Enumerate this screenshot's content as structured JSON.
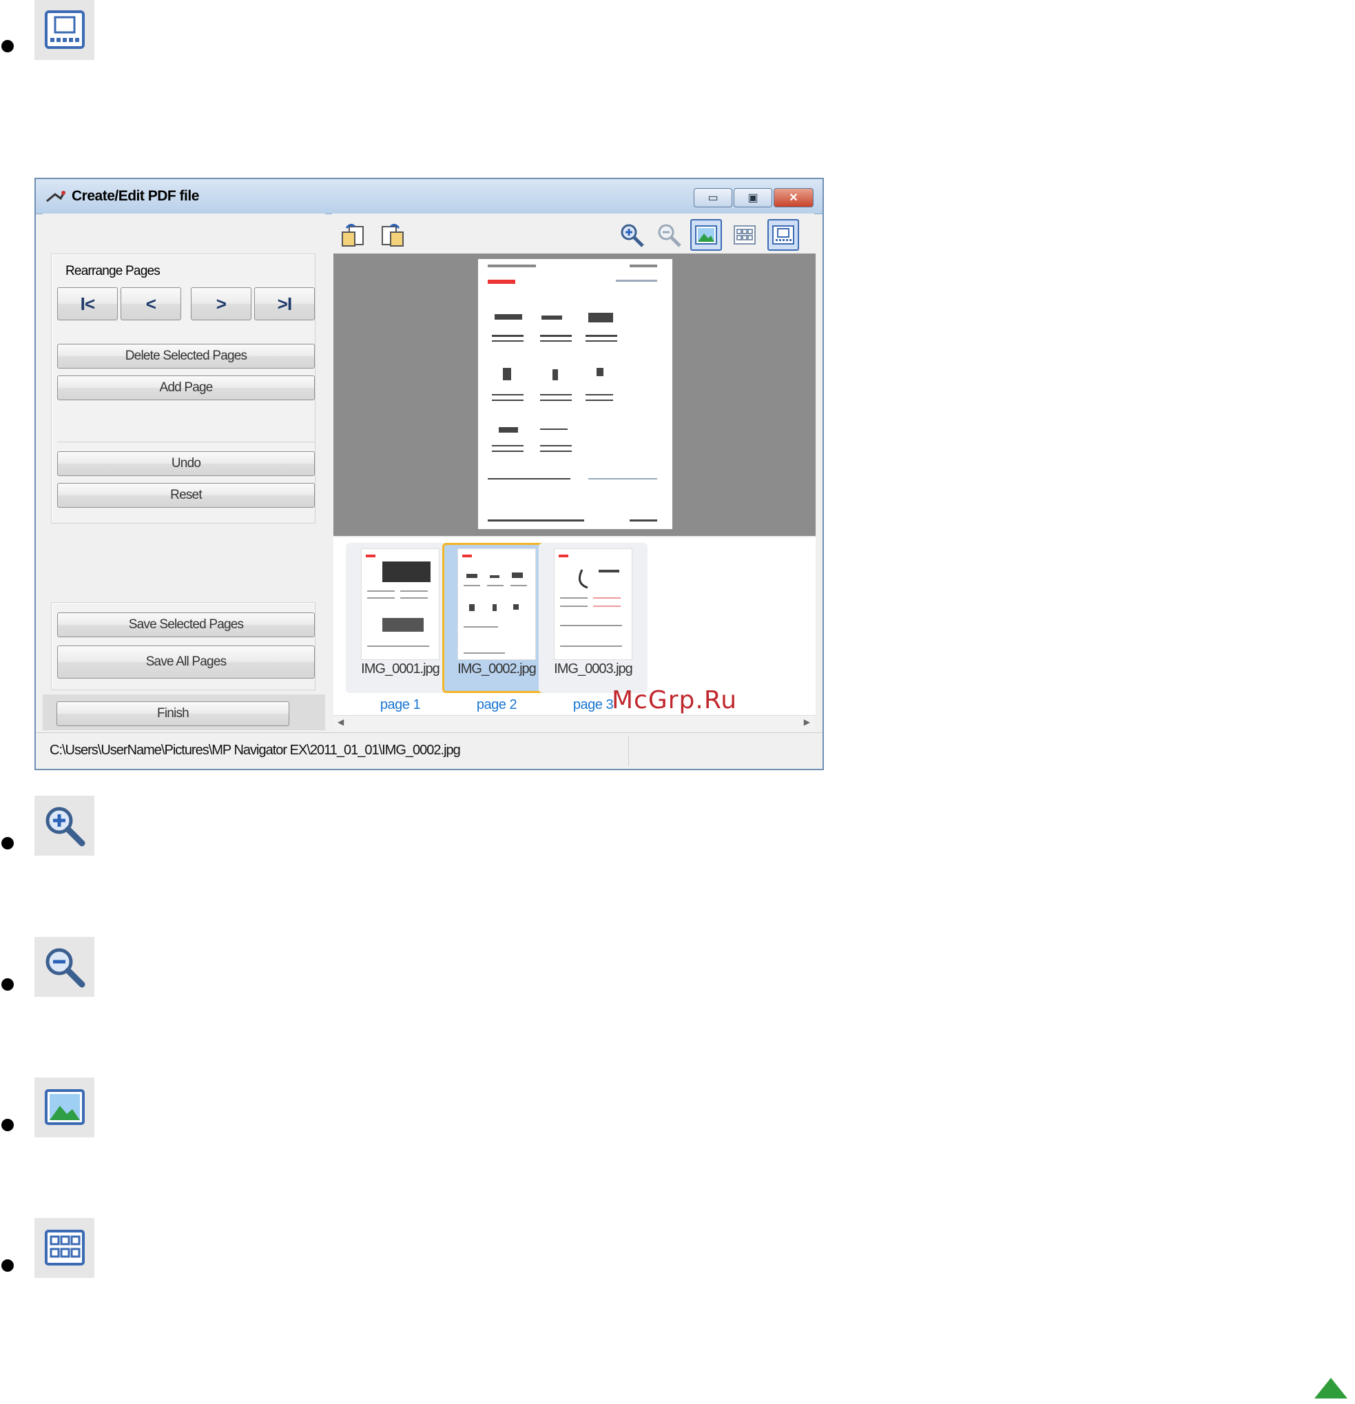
{
  "window": {
    "title": "Create/Edit PDF file",
    "minimize": "▭",
    "maximize": "▣",
    "close": "✕"
  },
  "left_panel": {
    "rearrange_label": "Rearrange Pages",
    "nav": {
      "first": "I<",
      "prev": "<",
      "next": ">",
      "last": ">I"
    },
    "delete_selected": "Delete Selected Pages",
    "add_page": "Add Page",
    "undo": "Undo",
    "reset": "Reset",
    "save_selected": "Save Selected Pages",
    "save_all": "Save All Pages",
    "finish": "Finish"
  },
  "thumbnails": [
    {
      "file": "IMG_0001.jpg",
      "page": "page 1",
      "selected": false
    },
    {
      "file": "IMG_0002.jpg",
      "page": "page 2",
      "selected": true
    },
    {
      "file": "IMG_0003.jpg",
      "page": "page 3",
      "selected": false
    }
  ],
  "status": {
    "path": "C:\\Users\\UserName\\Pictures\\MP Navigator EX\\2011_01_01\\IMG_0002.jpg"
  },
  "watermark": "McGrp.Ru",
  "icons": {
    "list": [
      "full-screen-icon",
      "zoom-in-icon",
      "zoom-out-icon",
      "view-image-icon",
      "view-thumbnails-icon"
    ]
  },
  "colors": {
    "accent": "#3b6ab4",
    "selection_border": "#f4b526",
    "page_link": "#1976d2"
  }
}
